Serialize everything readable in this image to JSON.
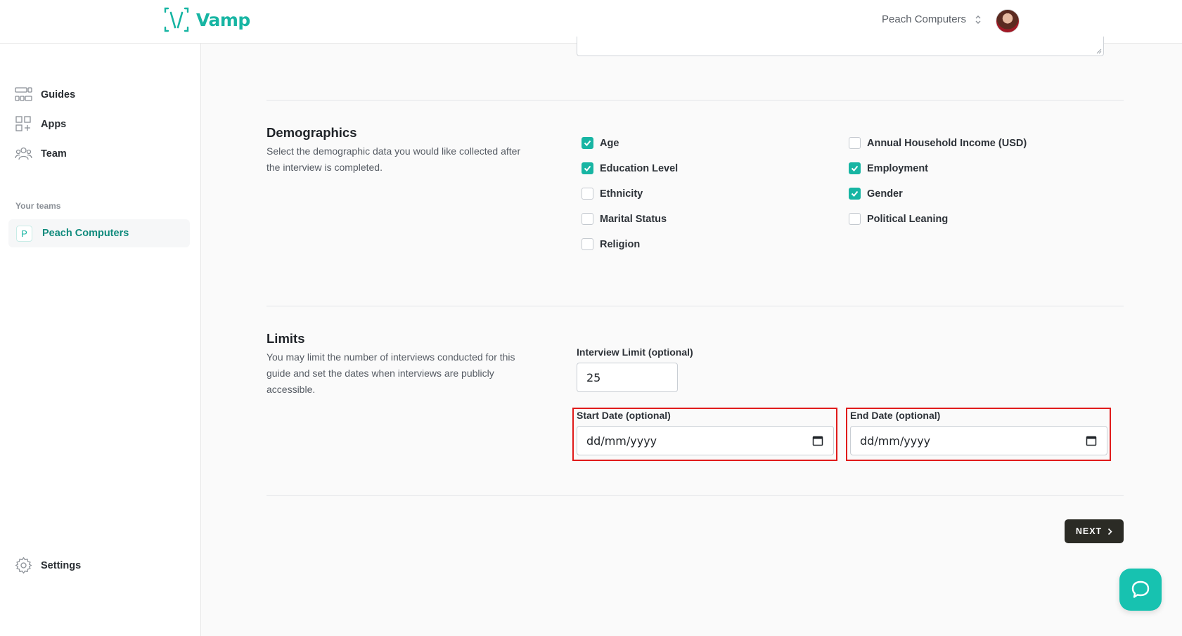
{
  "header": {
    "brand": "Vamp",
    "team_switcher": "Peach Computers"
  },
  "sidebar": {
    "items": [
      {
        "label": "Guides",
        "icon": "guides-icon"
      },
      {
        "label": "Apps",
        "icon": "apps-icon"
      },
      {
        "label": "Team",
        "icon": "team-icon"
      }
    ],
    "teams_label": "Your teams",
    "team": {
      "badge": "P",
      "name": "Peach Computers"
    },
    "settings_label": "Settings"
  },
  "demographics": {
    "title": "Demographics",
    "description": "Select the demographic data you would like collected after the interview is completed.",
    "options": [
      {
        "label": "Age",
        "checked": true
      },
      {
        "label": "Annual Household Income (USD)",
        "checked": false
      },
      {
        "label": "Education Level",
        "checked": true
      },
      {
        "label": "Employment",
        "checked": true
      },
      {
        "label": "Ethnicity",
        "checked": false
      },
      {
        "label": "Gender",
        "checked": true
      },
      {
        "label": "Marital Status",
        "checked": false
      },
      {
        "label": "Political Leaning",
        "checked": false
      },
      {
        "label": "Religion",
        "checked": false
      }
    ]
  },
  "limits": {
    "title": "Limits",
    "description": "You may limit the number of interviews conducted for this guide and set the dates when interviews are publicly accessible.",
    "interview_limit_label": "Interview Limit (optional)",
    "interview_limit_value": "25",
    "start_date_label": "Start Date (optional)",
    "start_date_value": "dd/mm/yyyy",
    "end_date_label": "End Date (optional)",
    "end_date_value": "dd/mm/yyyy"
  },
  "actions": {
    "next_label": "NEXT"
  },
  "colors": {
    "accent": "#17b5a3",
    "highlight": "#e01b1b",
    "next_button": "#2b2b25"
  }
}
